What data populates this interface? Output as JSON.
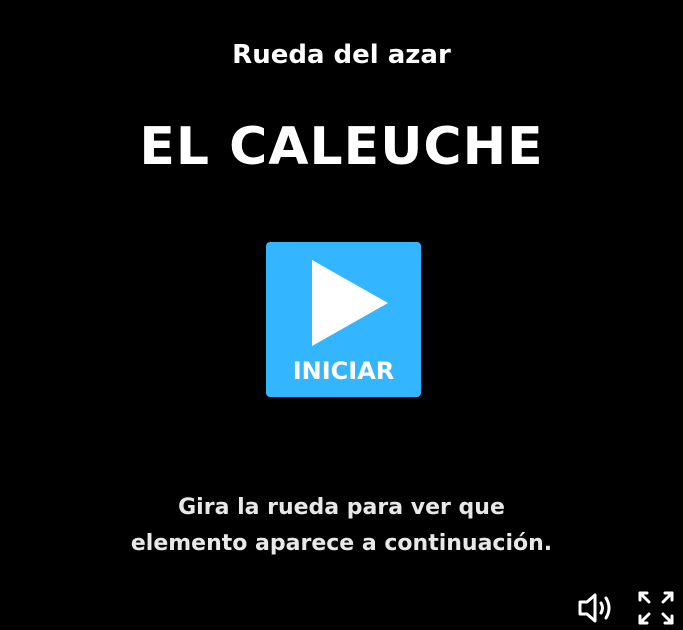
{
  "game": {
    "subtitle": "Rueda del azar",
    "title": "EL CALEUCHE",
    "start_button": {
      "label": "INICIAR",
      "icon": "play-icon",
      "color": "#33b5ff"
    },
    "instructions": {
      "line1": "Gira la rueda para ver que",
      "line2": "elemento aparece a continuación."
    }
  },
  "controls": {
    "sound_icon": "speaker-icon",
    "fullscreen_icon": "fullscreen-icon"
  },
  "colors": {
    "background": "#000000",
    "text": "#ffffff",
    "accent": "#33b5ff"
  }
}
